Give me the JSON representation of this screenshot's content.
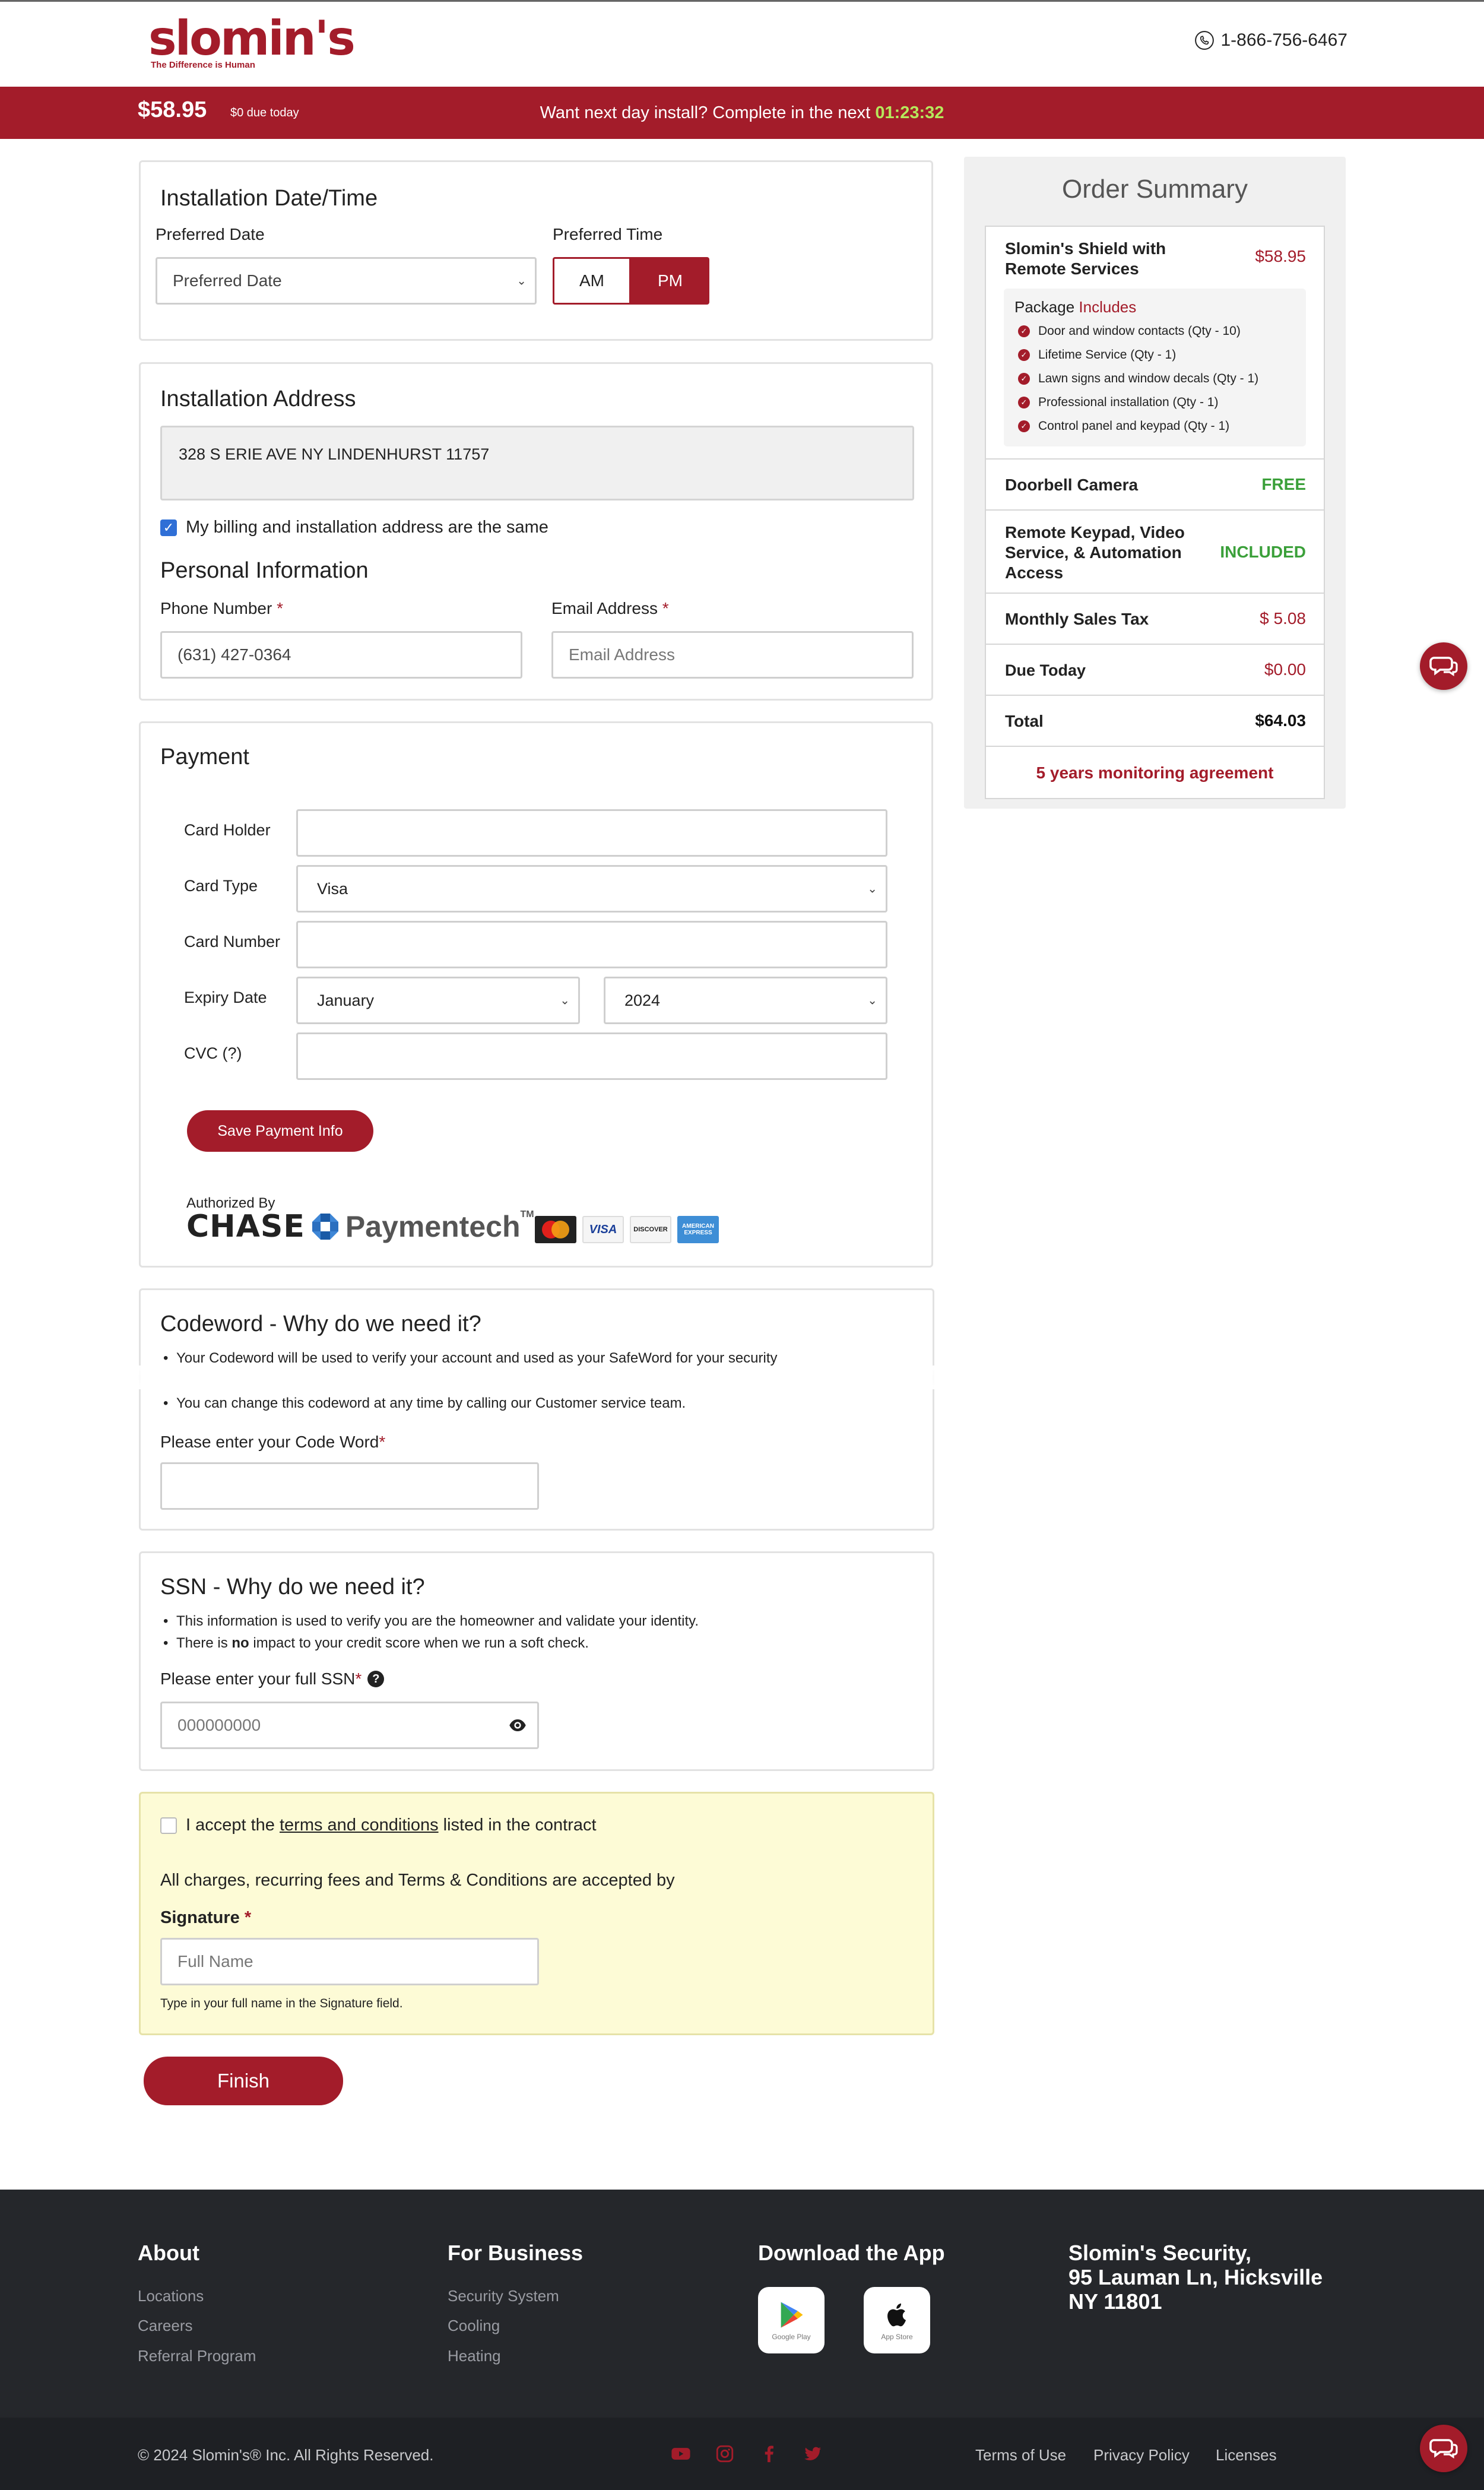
{
  "header": {
    "logo_word": "slomin's",
    "logo_tagline": "The Difference is Human",
    "phone": "1-866-756-6467"
  },
  "banner": {
    "price": "$58.95",
    "due_today": "$0 due today",
    "message": "Want next day install? Complete in the next",
    "countdown": "01:23:32"
  },
  "installation": {
    "title": "Installation Date/Time",
    "date_label": "Preferred Date",
    "date_value": "Preferred Date",
    "time_label": "Preferred Time",
    "am": "AM",
    "pm": "PM",
    "selected_time": "PM"
  },
  "address": {
    "title": "Installation Address",
    "value": "328 S ERIE AVE NY LINDENHURST 11757",
    "same_billing_label": "My billing and installation address are the same",
    "same_billing_checked": true
  },
  "personal": {
    "title": "Personal Information",
    "phone_label": "Phone Number",
    "phone_value": "(631) 427-0364",
    "email_label": "Email Address",
    "email_placeholder": "Email Address"
  },
  "payment": {
    "title": "Payment",
    "card_holder_label": "Card Holder",
    "card_holder_value": "",
    "card_type_label": "Card Type",
    "card_type_value": "Visa",
    "card_number_label": "Card Number",
    "card_number_value": "",
    "expiry_label": "Expiry Date",
    "expiry_month": "January",
    "expiry_year": "2024",
    "cvc_label": "CVC (?)",
    "cvc_value": "",
    "save_button": "Save Payment Info",
    "authorized_by": "Authorized By",
    "processor_word": "CHASE",
    "processor_name": "Paymentech",
    "trademark": "TM",
    "card_logos": {
      "mastercard": "MasterCard",
      "visa": "VISA",
      "discover": "DISCOVER",
      "amex": "AMERICAN EXPRESS"
    }
  },
  "codeword": {
    "title": "Codeword - Why do we need it?",
    "bullet1": "Your Codeword will be used to verify your account and used as your SafeWord for your security",
    "bullet2": "You can change this codeword at any time by calling our Customer service team.",
    "label": "Please enter your Code Word",
    "value": ""
  },
  "ssn": {
    "title": "SSN - Why do we need it?",
    "bullet1": "This information is used to verify you are the homeowner and validate your identity.",
    "bullet2_pre": "There is ",
    "bullet2_bold": "no",
    "bullet2_post": " impact to your credit score when we run a soft check.",
    "label": "Please enter your full SSN",
    "placeholder": "000000000"
  },
  "terms": {
    "accept_pre": "I accept the ",
    "accept_link": "terms and conditions",
    "accept_post": " listed in the contract",
    "accepted": false,
    "charges_text": "All charges, recurring fees and Terms & Conditions are accepted by",
    "signature_label": "Signature",
    "signature_placeholder": "Full Name",
    "signature_hint": "Type in your full name in the Signature field."
  },
  "finish_button": "Finish",
  "summary": {
    "title": "Order Summary",
    "product_name": "Slomin's Shield with Remote Services",
    "product_price": "$58.95",
    "package_title": "Package",
    "package_includes": "Includes",
    "package_items": [
      "Door and window contacts (Qty - 10)",
      "Lifetime Service (Qty - 1)",
      "Lawn signs and window decals (Qty - 1)",
      "Professional installation (Qty - 1)",
      "Control panel and keypad (Qty - 1)"
    ],
    "doorbell_name": "Doorbell Camera",
    "doorbell_value": "FREE",
    "remote_name": "Remote Keypad, Video Service, & Automation Access",
    "remote_value": "INCLUDED",
    "tax_name": "Monthly Sales Tax",
    "tax_value": "$ 5.08",
    "due_name": "Due Today",
    "due_value": "$0.00",
    "total_name": "Total",
    "total_value": "$64.03",
    "agreement": "5 years monitoring agreement"
  },
  "footer": {
    "about_title": "About",
    "about_links": [
      "Locations",
      "Careers",
      "Referral Program"
    ],
    "business_title": "For Business",
    "business_links": [
      "Security System",
      "Cooling",
      "Heating"
    ],
    "app_title": "Download the App",
    "google_caption": "Google Play",
    "apple_caption": "App Store",
    "company_line1": "Slomin's Security,",
    "company_line2": "95 Lauman Ln, Hicksville",
    "company_line3": "NY 11801",
    "copyright": "© 2024 Slomin's® Inc. All Rights Reserved.",
    "legal_links": [
      "Terms of Use",
      "Privacy Policy",
      "Licenses"
    ]
  },
  "colors": {
    "brand_red": "#a31c2a",
    "timer_green": "#b6e85c",
    "free_green": "#3ba03a",
    "footer_bg": "#25272b",
    "terms_bg": "#fdfbd6"
  }
}
